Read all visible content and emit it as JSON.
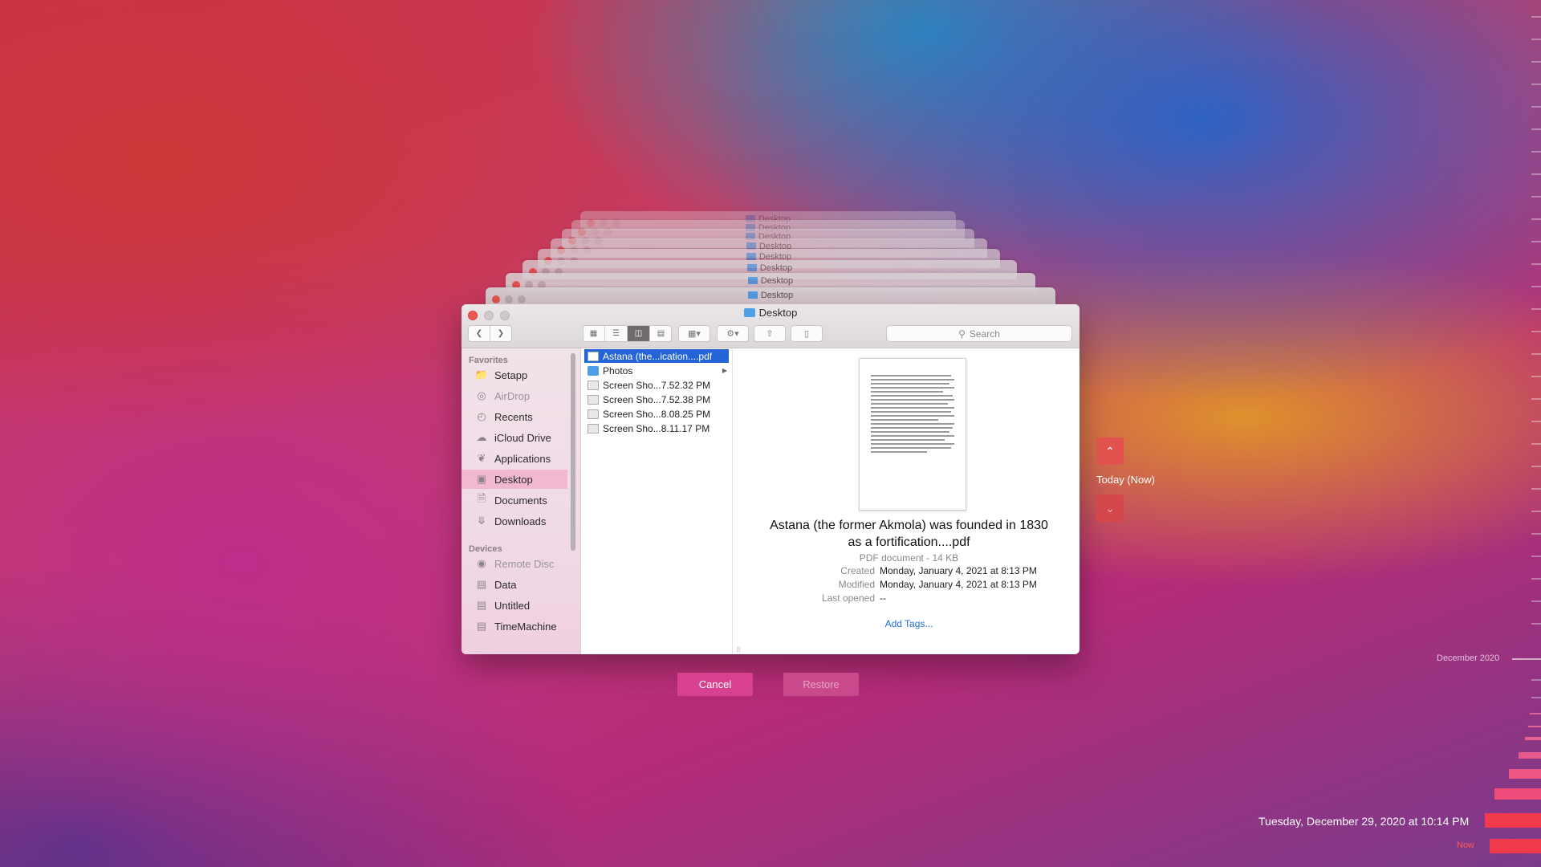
{
  "window": {
    "title": "Desktop"
  },
  "stack_titles": [
    "Desktop",
    "Desktop",
    "Desktop",
    "Desktop",
    "Desktop",
    "Desktop",
    "Desktop",
    "Desktop"
  ],
  "toolbar": {
    "search_placeholder": "Search",
    "back_icon": "chevron-left-icon",
    "forward_icon": "chevron-right-icon",
    "view_modes": [
      "icon-view",
      "list-view",
      "column-view",
      "gallery-view"
    ],
    "active_view": "column-view"
  },
  "sidebar": {
    "favorites_header": "Favorites",
    "devices_header": "Devices",
    "favorites": [
      {
        "label": "Setapp",
        "icon": "folder-icon"
      },
      {
        "label": "AirDrop",
        "icon": "airdrop-icon",
        "dim": true
      },
      {
        "label": "Recents",
        "icon": "clock-icon"
      },
      {
        "label": "iCloud Drive",
        "icon": "cloud-icon"
      },
      {
        "label": "Applications",
        "icon": "applications-icon"
      },
      {
        "label": "Desktop",
        "icon": "desktop-icon",
        "selected": true
      },
      {
        "label": "Documents",
        "icon": "document-icon"
      },
      {
        "label": "Downloads",
        "icon": "download-icon"
      }
    ],
    "devices": [
      {
        "label": "Remote Disc",
        "icon": "disc-icon",
        "dim": true
      },
      {
        "label": "Data",
        "icon": "drive-icon"
      },
      {
        "label": "Untitled",
        "icon": "drive-icon"
      },
      {
        "label": "TimeMachine",
        "icon": "drive-icon"
      }
    ]
  },
  "files": [
    {
      "name": "Astana (the...ication....pdf",
      "type": "pdf",
      "selected": true
    },
    {
      "name": "Photos",
      "type": "folder",
      "has_children": true
    },
    {
      "name": "Screen Sho...7.52.32 PM",
      "type": "image"
    },
    {
      "name": "Screen Sho...7.52.38 PM",
      "type": "image"
    },
    {
      "name": "Screen Sho...8.08.25 PM",
      "type": "image"
    },
    {
      "name": "Screen Sho...8.11.17 PM",
      "type": "image"
    }
  ],
  "preview": {
    "name_line1": "Astana (the former Akmola) was founded in 1830",
    "name_line2": "as a fortification....pdf",
    "kind": "PDF document - 14 KB",
    "meta": [
      {
        "label": "Created",
        "value": "Monday, January 4, 2021 at 8:13 PM"
      },
      {
        "label": "Modified",
        "value": "Monday, January 4, 2021 at 8:13 PM"
      },
      {
        "label": "Last opened",
        "value": "--"
      }
    ],
    "add_tags": "Add Tags..."
  },
  "buttons": {
    "cancel": "Cancel",
    "restore": "Restore"
  },
  "timemachine": {
    "today_label": "Today (Now)",
    "month_label": "December 2020",
    "current_date": "Tuesday, December 29, 2020 at 10:14 PM",
    "now_label": "Now",
    "accent": "#f23a4d"
  }
}
